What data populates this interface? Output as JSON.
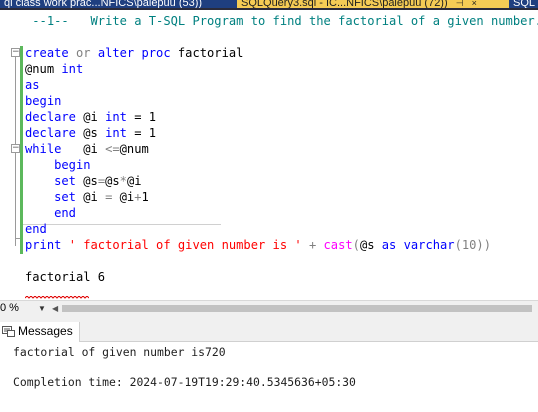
{
  "tabs": [
    {
      "label": "ql class work prac...NFICS\\palepuu (53))",
      "active": false
    },
    {
      "label": "SQLQuery3.sql - IC...NFICS\\palepuu (72))",
      "active": true
    },
    {
      "label": "SQL",
      "active": false
    }
  ],
  "tab_pin_glyph": "⊣",
  "tab_close_glyph": "×",
  "editor": {
    "lines": [
      {
        "kind": "comment",
        "text": " --1--   Write a T-SQL Program to find the factorial of a given number."
      },
      {
        "kind": "create",
        "t1": "create",
        "t2": " or ",
        "t3": "alter",
        "t4": " ",
        "t5": "proc",
        "t6": " factorial"
      },
      {
        "kind": "param",
        "t1": "@num ",
        "t2": "int"
      },
      {
        "kind": "as",
        "t1": "as"
      },
      {
        "kind": "begin",
        "t1": "begin"
      },
      {
        "kind": "declare",
        "t1": "declare",
        "t2": " @i ",
        "t3": "int",
        "t4": " = 1"
      },
      {
        "kind": "declare",
        "t1": "declare",
        "t2": " @s ",
        "t3": "int",
        "t4": " = 1"
      },
      {
        "kind": "while",
        "t1": "while",
        "t2": "   @i ",
        "t3": "<=",
        "t4": "@num"
      },
      {
        "kind": "inner",
        "t1": "    begin"
      },
      {
        "kind": "set",
        "t1": "    set",
        "t2": " @s",
        "t3": "=",
        "t4": "@s",
        "t5": "*",
        "t6": "@i"
      },
      {
        "kind": "set",
        "t1": "    set",
        "t2": " @i ",
        "t3": "=",
        "t4": " @i",
        "t5": "+",
        "t6": "1"
      },
      {
        "kind": "inner",
        "t1": "    end"
      },
      {
        "kind": "end",
        "t1": "end"
      },
      {
        "kind": "print",
        "t1": "print",
        "t2": " ",
        "t3": "' factorial of given number is '",
        "t4": " + ",
        "t5": "cast",
        "t6": "(",
        "t7": "@s ",
        "t8": "as",
        "t9": " ",
        "t10": "varchar",
        "t11": "(10))"
      },
      {
        "kind": "exec",
        "t1": "factorial 6"
      }
    ]
  },
  "zoom": {
    "value": "0 %"
  },
  "results": {
    "tab_label": "Messages",
    "lines": [
      "factorial of given number is720",
      "Completion time: 2024-07-19T19:29:40.5345636+05:30"
    ]
  },
  "colors": {
    "keyword": "#0000ff",
    "gray_operator": "#808080",
    "function": "#ff00ff",
    "string": "#ff0000",
    "comment": "#008080",
    "tab_active": "#f5cc55",
    "tab_inactive": "#1f3f80",
    "change_bar": "#5cb85c"
  }
}
